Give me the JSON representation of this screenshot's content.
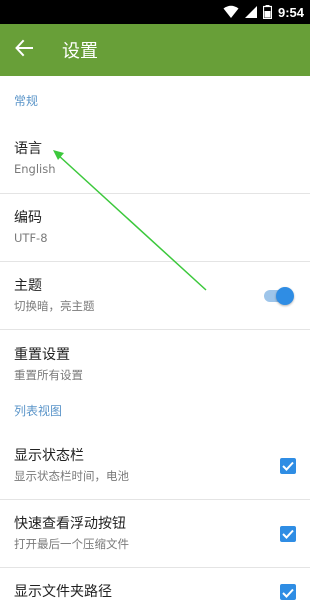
{
  "status_bar": {
    "time": "9:54"
  },
  "app_bar": {
    "title": "设置"
  },
  "sections": {
    "general": {
      "header": "常规",
      "language": {
        "title": "语言",
        "summary": "English"
      },
      "encoding": {
        "title": "编码",
        "summary": "UTF-8"
      },
      "theme": {
        "title": "主题",
        "summary": "切换暗，亮主题",
        "enabled": true
      },
      "reset": {
        "title": "重置设置",
        "summary": "重置所有设置"
      }
    },
    "list_view": {
      "header": "列表视图",
      "show_status_bar": {
        "title": "显示状态栏",
        "summary": "显示状态栏时间，电池",
        "checked": true
      },
      "quick_view_fab": {
        "title": "快速查看浮动按钮",
        "summary": "打开最后一个压缩文件",
        "checked": true
      },
      "show_folder_path": {
        "title": "显示文件夹路径",
        "checked": true
      }
    }
  },
  "colors": {
    "app_bar": "#689f38",
    "accent": "#2f8de4",
    "section_header": "#5b95c9",
    "annotation_arrow": "#3cc83c"
  }
}
